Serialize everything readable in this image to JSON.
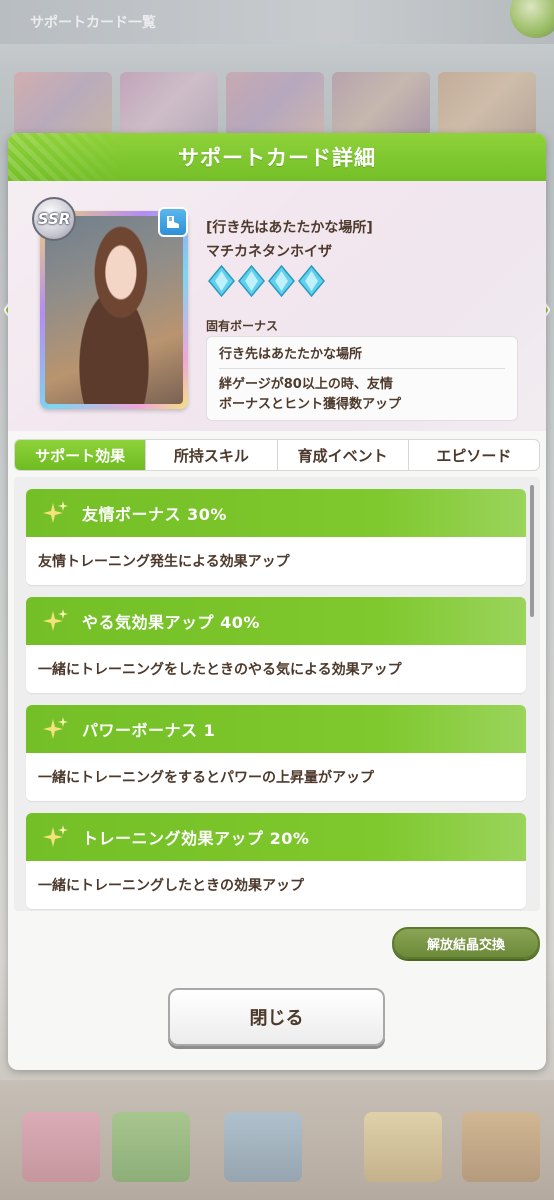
{
  "background": {
    "title": "サポートカード一覧"
  },
  "dialog": {
    "title": "サポートカード詳細"
  },
  "card": {
    "rarity": "SSR",
    "type_icon": "speed-shoe-icon",
    "name_bracket": "[行き先はあたたかな場所]",
    "name": "マチカネタンホイザ",
    "limit_break_gems": 4,
    "unique_bonus_label": "固有ボーナス",
    "unique_bonus_title": "行き先はあたたかな場所",
    "unique_bonus_desc_line1": "絆ゲージが80以上の時、友情",
    "unique_bonus_desc_line2": "ボーナスとヒント獲得数アップ"
  },
  "tabs": [
    {
      "label": "サポート効果",
      "active": true
    },
    {
      "label": "所持スキル",
      "active": false
    },
    {
      "label": "育成イベント",
      "active": false
    },
    {
      "label": "エピソード",
      "active": false
    }
  ],
  "effects": [
    {
      "title": "友情ボーナス 30%",
      "desc": "友情トレーニング発生による効果アップ"
    },
    {
      "title": "やる気効果アップ 40%",
      "desc": "一緒にトレーニングをしたときのやる気による効果アップ"
    },
    {
      "title": "パワーボーナス 1",
      "desc": "一緒にトレーニングをするとパワーの上昇量がアップ"
    },
    {
      "title": "トレーニング効果アップ 20%",
      "desc": "一緒にトレーニングしたときの効果アップ"
    }
  ],
  "buttons": {
    "exchange": "解放結晶交換",
    "close": "閉じる"
  },
  "colors": {
    "accent_green": "#74bf27",
    "text_brown": "#4d3a2c",
    "gem_blue": "#5fd0ee"
  }
}
